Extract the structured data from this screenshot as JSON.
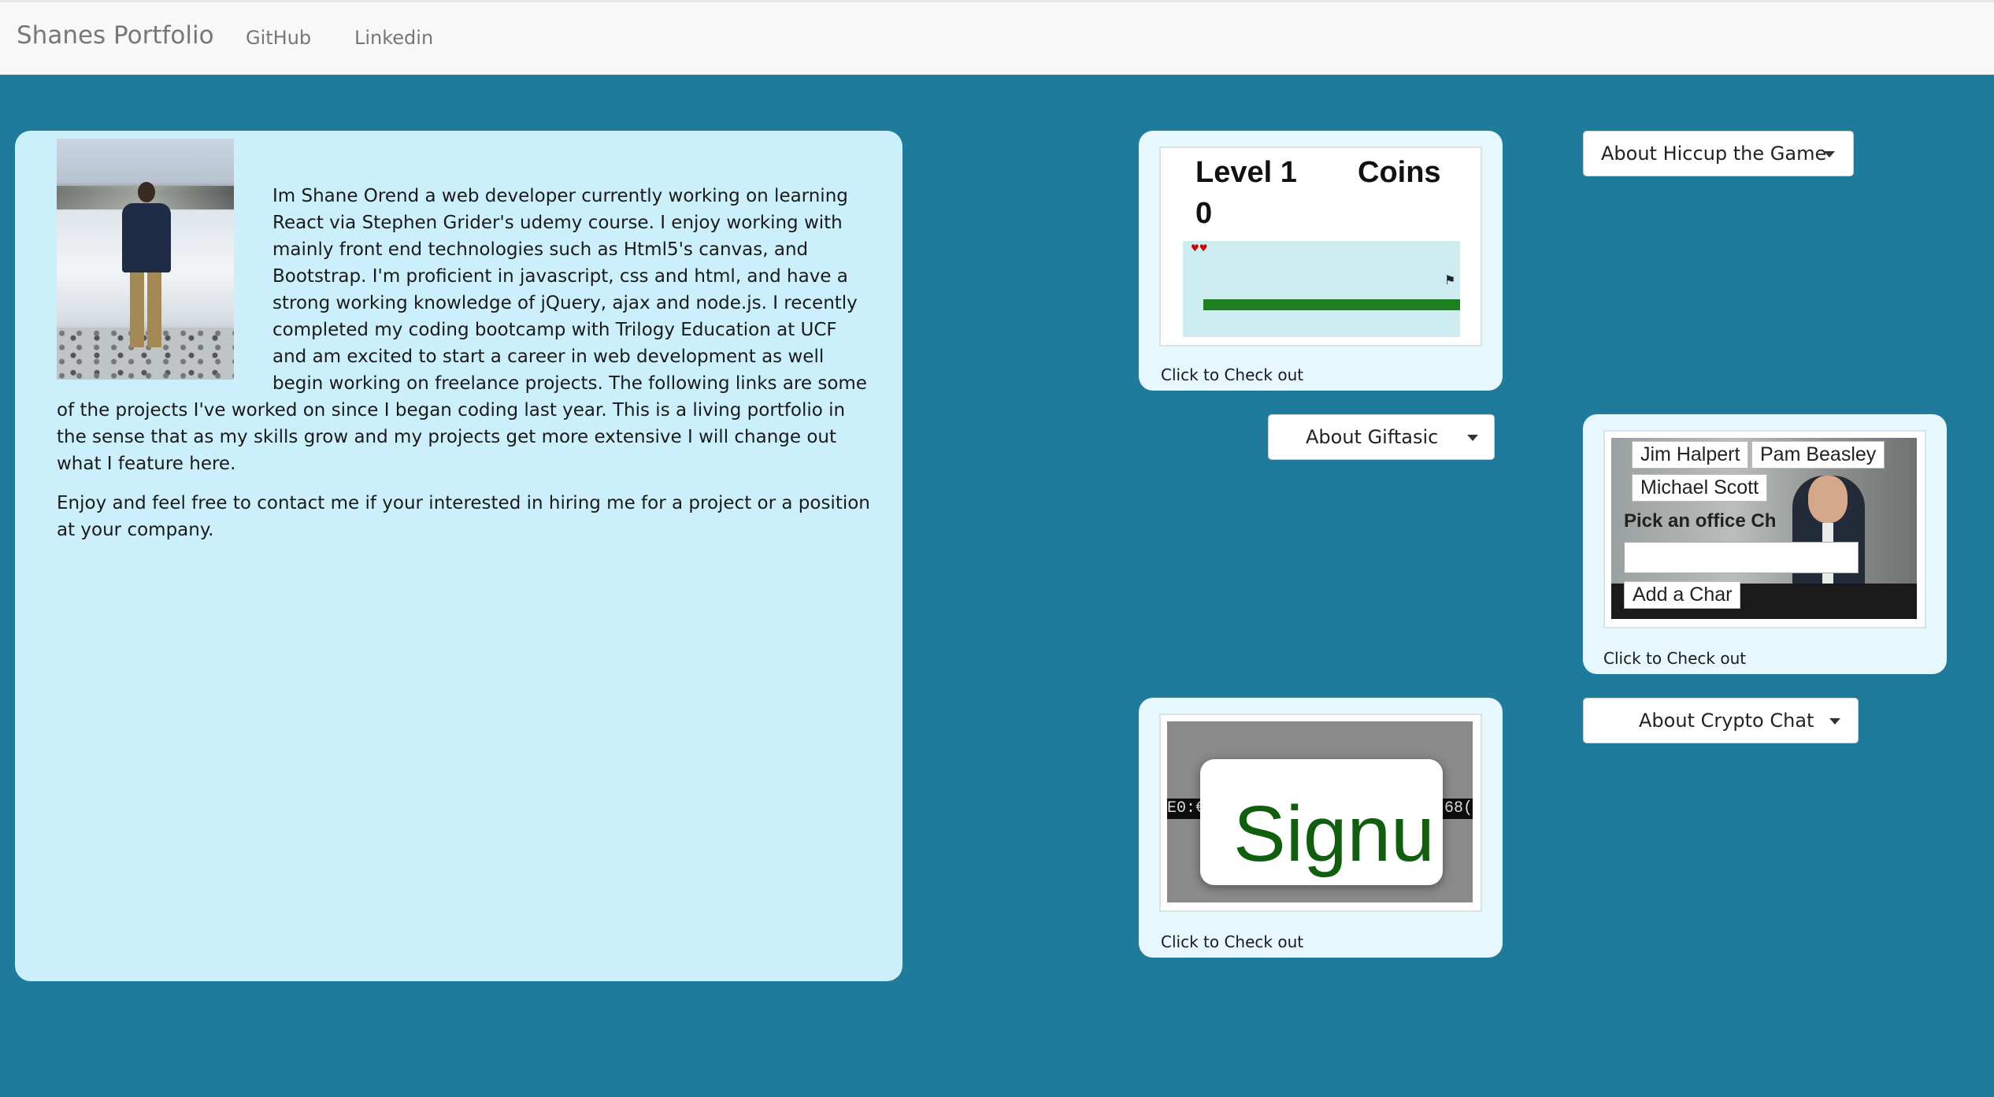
{
  "navbar": {
    "brand": "Shanes Portfolio",
    "links": [
      "GitHub",
      "Linkedin"
    ]
  },
  "about": {
    "paragraph1": "Im Shane Orend a web developer currently working on learning React via Stephen Grider's udemy course. I enjoy working with mainly front end technologies such as Html5's canvas, and Bootstrap. I'm proficient in javascript, css and html, and have a strong working knowledge of jQuery, ajax and node.js. I recently completed my coding bootcamp with Trilogy Education at UCF and am excited to start a career in web development as well begin working on freelance projects. The following links are some of the projects I've worked on since I began coding last year. This is a living portfolio in the sense that as my skills grow and my projects get more extensive I will change out what I feature here.",
    "paragraph2": "Enjoy and feel free to contact me if your interested in hiring me for a project or a position at your company."
  },
  "projects": {
    "hiccup": {
      "dropdown_label": "About Hiccup the Game",
      "caption": "Click to Check out",
      "thumb": {
        "level": "Level 1",
        "coins": "Coins",
        "coins_value": "0"
      }
    },
    "giftasic": {
      "dropdown_label": "About Giftasic",
      "caption": "Click to Check out",
      "thumb": {
        "buttons": [
          "Jim Halpert",
          "Pam Beasley",
          "Michael Scott"
        ],
        "prompt": "Pick an office Ch",
        "add_button": "Add a Char"
      }
    },
    "crypto": {
      "dropdown_label": "About Crypto Chat",
      "caption": "Click to Check out",
      "thumb": {
        "ticker_left": "E0:€",
        "ticker_right": "68(",
        "signup_text": "Signu"
      }
    }
  },
  "colors": {
    "page_background": "#1f7b9c",
    "about_panel": "#ccf0fb",
    "card_background": "#e6f7fd",
    "navbar": "#f8f8f8"
  },
  "icons": {
    "dropdown": "caret-down-icon",
    "game_heart": "heart-icon",
    "game_flag": "checkered-flag-icon"
  }
}
